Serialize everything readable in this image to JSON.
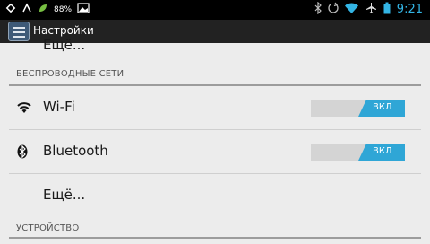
{
  "status_bar": {
    "battery_percent": "88%",
    "time": "9:21"
  },
  "action_bar": {
    "title": "Настройки"
  },
  "list": {
    "top_partial_item": "Ещё...",
    "wireless_header": "БЕСПРОВОДНЫЕ СЕТИ",
    "wifi": {
      "label": "Wi-Fi",
      "toggle_label": "ВКЛ",
      "enabled": true
    },
    "bluetooth": {
      "label": "Bluetooth",
      "toggle_label": "ВКЛ",
      "enabled": true
    },
    "more_item": "Ещё...",
    "device_header": "УСТРОЙСТВО"
  },
  "colors": {
    "toggle_on": "#2fa6d6",
    "clock": "#33b5e5"
  }
}
